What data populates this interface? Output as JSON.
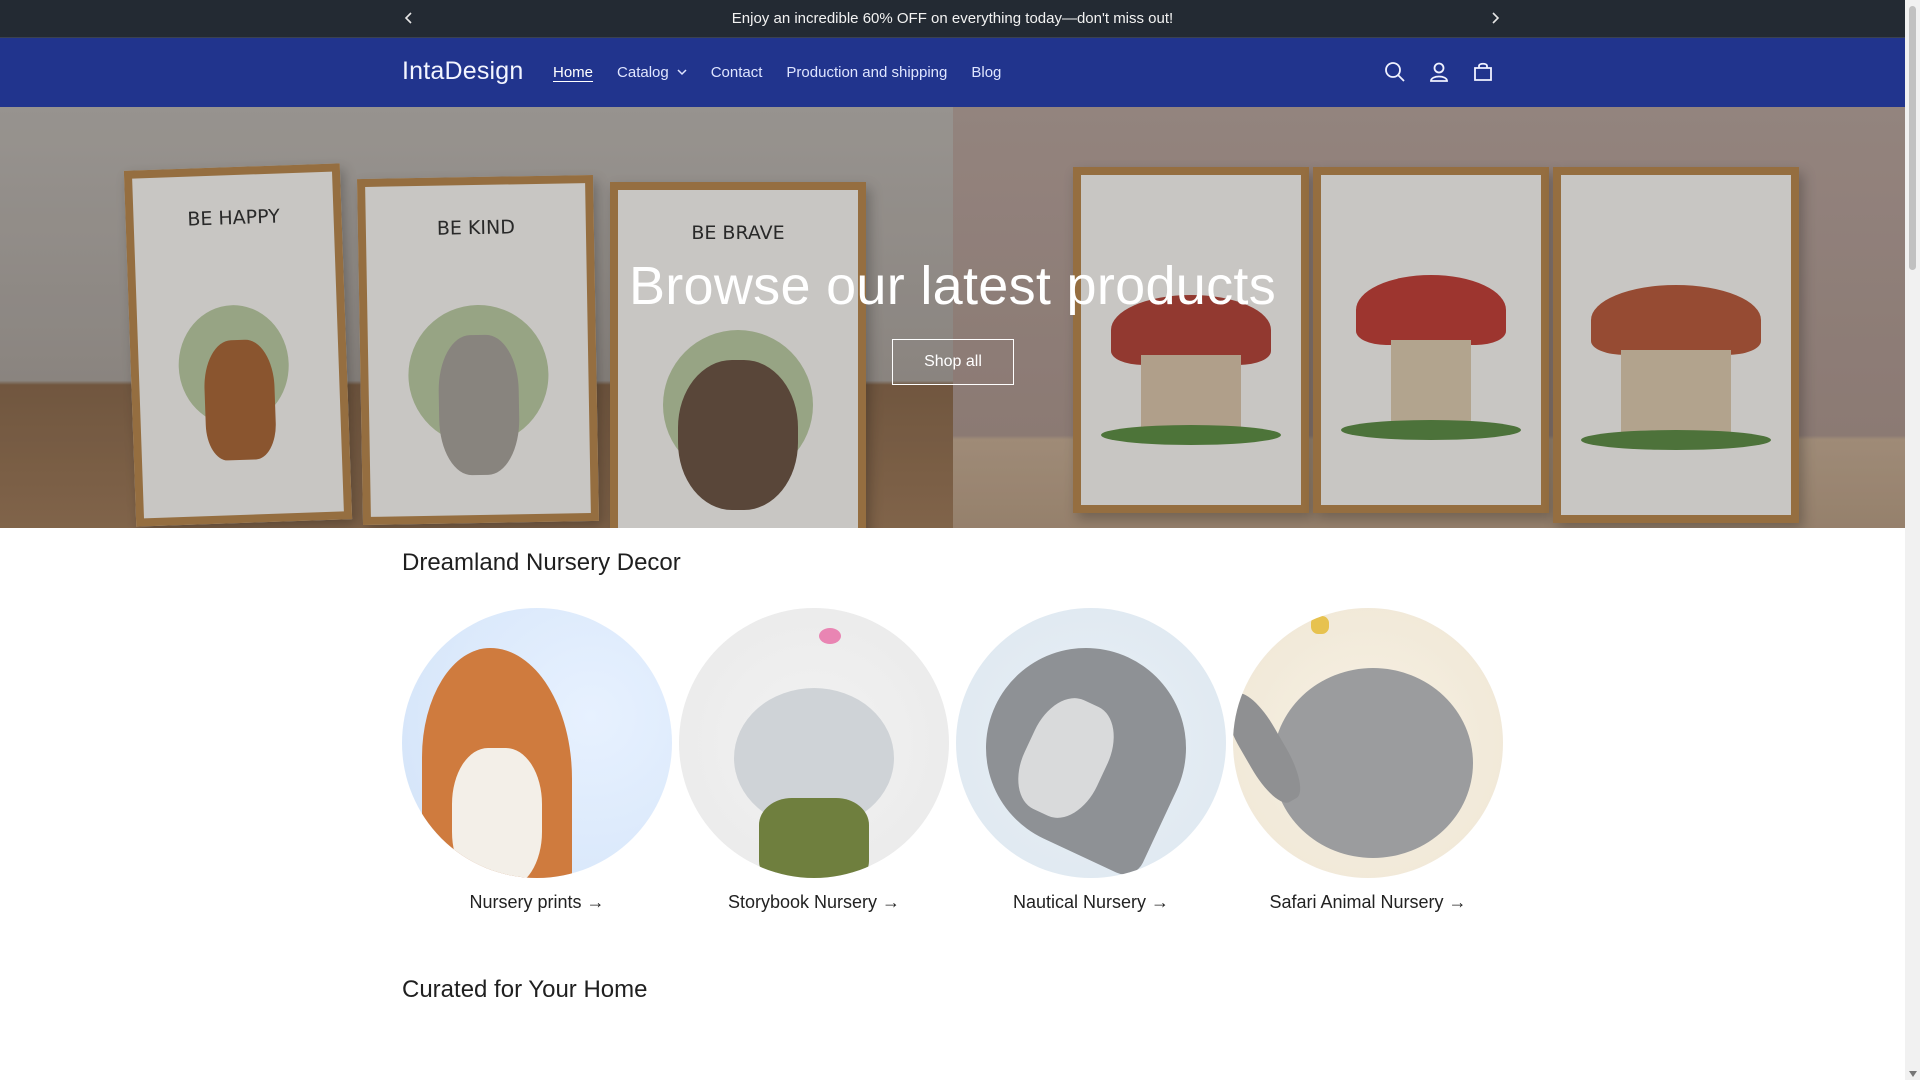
{
  "announcement": {
    "text": "Enjoy an incredible 60% OFF on everything today—don't miss out!"
  },
  "header": {
    "logo": "IntaDesign",
    "nav": [
      {
        "label": "Home",
        "active": true
      },
      {
        "label": "Catalog"
      },
      {
        "label": "Contact"
      },
      {
        "label": "Production and shipping"
      },
      {
        "label": "Blog"
      }
    ],
    "icons": [
      "search-icon",
      "account-icon",
      "cart-icon"
    ]
  },
  "hero": {
    "title": "Browse our latest products",
    "button": "Shop all",
    "frames_left": [
      "BE HAPPY",
      "BE KIND",
      "BE BRAVE"
    ]
  },
  "sections": {
    "collections_title": "Dreamland Nursery Decor",
    "collections": [
      {
        "label": "Nursery prints →"
      },
      {
        "label": "Storybook Nursery →"
      },
      {
        "label": "Nautical Nursery →"
      },
      {
        "label": "Safari Animal Nursery →"
      }
    ],
    "curated_title": "Curated for Your Home"
  },
  "colors": {
    "announcement_bg": "#232a33",
    "header_bg": "#21348d",
    "text": "#222222"
  }
}
